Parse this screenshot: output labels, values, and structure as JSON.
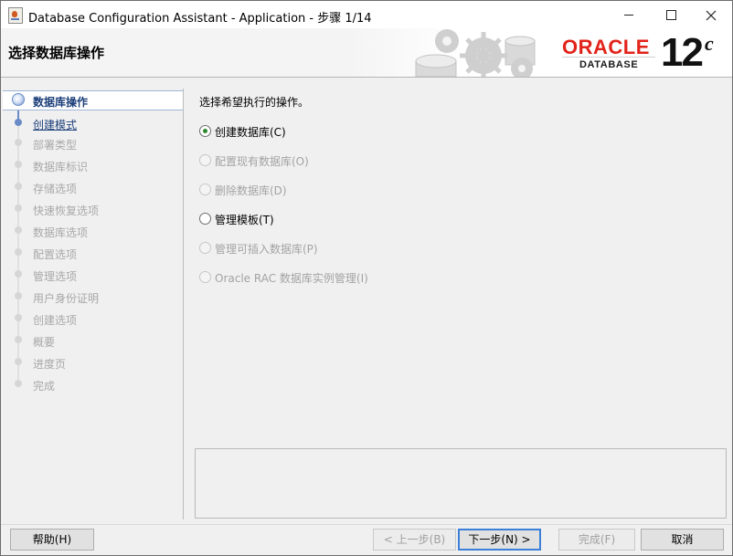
{
  "window": {
    "title": "Database Configuration Assistant - Application - 步骤 1/14",
    "controls": {
      "minimize": "—",
      "maximize": "☐",
      "close": "✕"
    }
  },
  "header": {
    "step_title": "选择数据库操作",
    "brand": {
      "oracle": "ORACLE",
      "product": "DATABASE",
      "version": "12",
      "version_suffix": "c",
      "brand_color": "#e2231a"
    }
  },
  "sidebar": {
    "steps": [
      {
        "label": "数据库操作",
        "state": "current"
      },
      {
        "label": "创建模式",
        "state": "link"
      },
      {
        "label": "部署类型",
        "state": "disabled"
      },
      {
        "label": "数据库标识",
        "state": "disabled"
      },
      {
        "label": "存储选项",
        "state": "disabled"
      },
      {
        "label": "快速恢复选项",
        "state": "disabled"
      },
      {
        "label": "数据库选项",
        "state": "disabled"
      },
      {
        "label": "配置选项",
        "state": "disabled"
      },
      {
        "label": "管理选项",
        "state": "disabled"
      },
      {
        "label": "用户身份证明",
        "state": "disabled"
      },
      {
        "label": "创建选项",
        "state": "disabled"
      },
      {
        "label": "概要",
        "state": "disabled"
      },
      {
        "label": "进度页",
        "state": "disabled"
      },
      {
        "label": "完成",
        "state": "disabled"
      }
    ]
  },
  "content": {
    "prompt": "选择希望执行的操作。",
    "options": [
      {
        "label": "创建数据库(C)",
        "selected": true,
        "enabled": true
      },
      {
        "label": "配置现有数据库(O)",
        "selected": false,
        "enabled": false
      },
      {
        "label": "删除数据库(D)",
        "selected": false,
        "enabled": false
      },
      {
        "label": "管理模板(T)",
        "selected": false,
        "enabled": true
      },
      {
        "label": "管理可插入数据库(P)",
        "selected": false,
        "enabled": false
      },
      {
        "label": "Oracle RAC 数据库实例管理(I)",
        "selected": false,
        "enabled": false
      }
    ]
  },
  "footer": {
    "help": "帮助(H)",
    "back": "< 上一步(B)",
    "next": "下一步(N) >",
    "finish": "完成(F)",
    "cancel": "取消"
  },
  "colors": {
    "accent": "#1d3f7a",
    "selected_radio": "#2f8a2f",
    "focus_border": "#3c7fd8"
  }
}
